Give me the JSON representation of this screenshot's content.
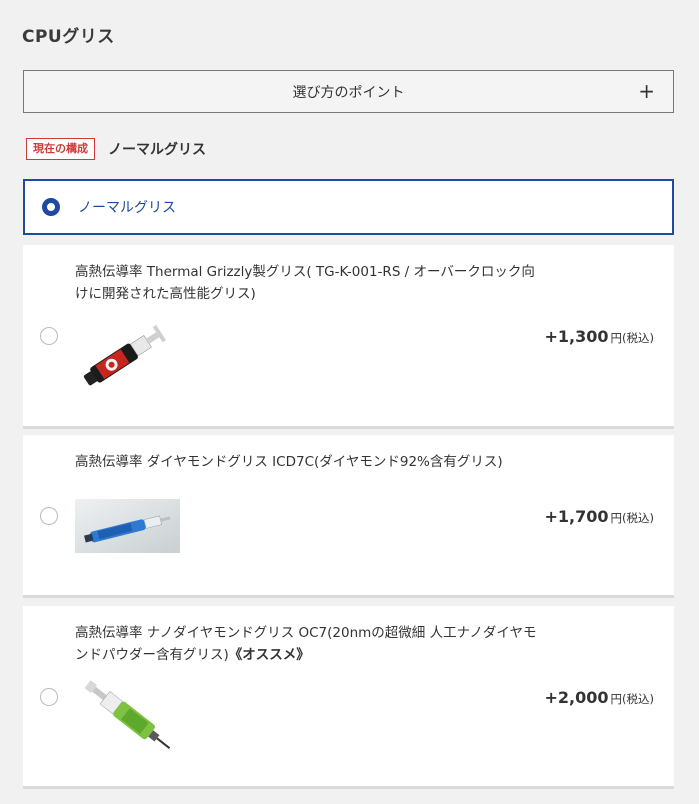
{
  "section": {
    "title": "CPUグリス"
  },
  "guide": {
    "label": "選び方のポイント",
    "toggle": "+"
  },
  "current": {
    "badge": "現在の構成",
    "value": "ノーマルグリス"
  },
  "selected_option": {
    "label": "ノーマルグリス",
    "checked": true
  },
  "options": [
    {
      "desc": "高熱伝導率 Thermal Grizzly製グリス( TG-K-001-RS / オーバークロック向けに開発された高性能グリス)",
      "price": "+1,300",
      "unit": "円(税込)",
      "image": "syringe-black-red-icon"
    },
    {
      "desc": "高熱伝導率 ダイヤモンドグリス ICD7C(ダイヤモンド92%含有グリス)",
      "price": "+1,700",
      "unit": "円(税込)",
      "image": "syringe-blue-photo"
    },
    {
      "desc": "高熱伝導率 ナノダイヤモンドグリス OC7(20nmの超微細 人工ナノダイヤモンドパウダー含有グリス)",
      "desc_emphasis": "《オススメ》",
      "price": "+2,000",
      "unit": "円(税込)",
      "image": "syringe-green-icon"
    }
  ],
  "colors": {
    "accent": "#1f4aa0",
    "badge": "#d03a3a",
    "background": "#f1f1f1"
  }
}
